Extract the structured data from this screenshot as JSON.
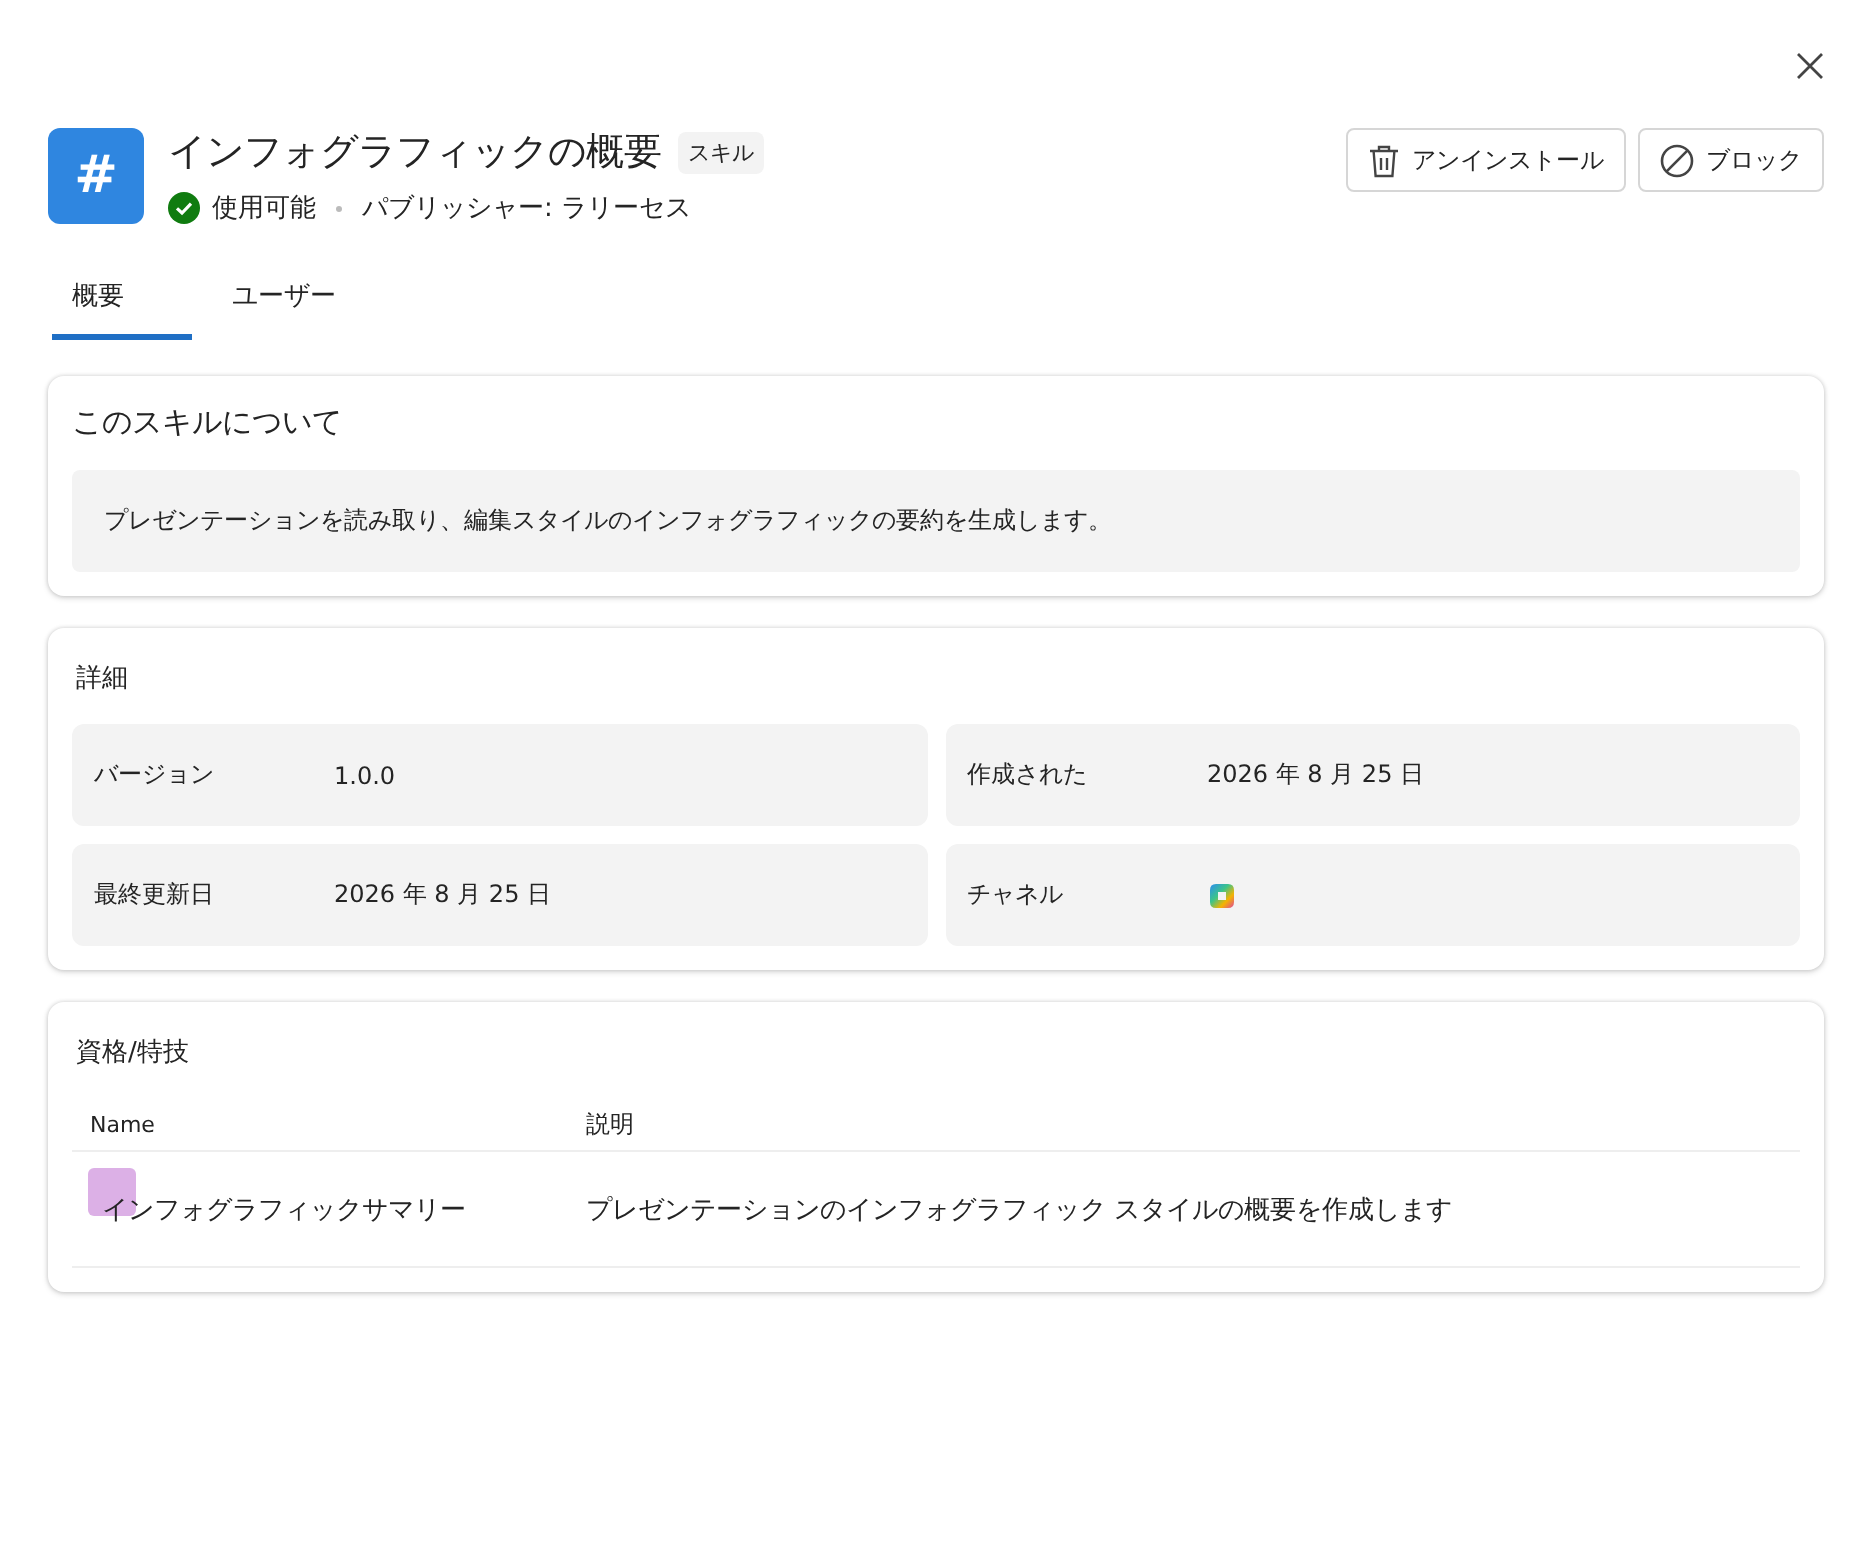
{
  "header": {
    "icon_glyph": "#",
    "title": "インフォグラフィックの概要",
    "badge": "スキル",
    "status": "使用可能",
    "publisher": "パブリッシャー: ラリーセス"
  },
  "actions": [
    {
      "kind": "uninstall",
      "label": "アンインストール"
    },
    {
      "kind": "block",
      "label": "ブロック"
    }
  ],
  "tabs": [
    {
      "label": "概要",
      "selected": true
    },
    {
      "label": "ユーザー",
      "selected": false
    }
  ],
  "about": {
    "title": "このスキルについて",
    "description": "プレゼンテーションを読み取り、編集スタイルのインフォグラフィックの要約を生成します。"
  },
  "details": {
    "title": "詳細",
    "fields": [
      {
        "label": "バージョン",
        "kind": "text",
        "value": "1.0.0"
      },
      {
        "label": "作成された",
        "kind": "text",
        "value": "2026 年 8 月 25 日"
      },
      {
        "label": "最終更新日",
        "kind": "text",
        "value": "2026 年 8 月 25 日"
      },
      {
        "label": "チャネル",
        "kind": "channel-icon"
      }
    ]
  },
  "capabilities": {
    "title": "資格/特技",
    "columns": [
      "Name",
      "説明"
    ],
    "rows": [
      {
        "name": "インフォグラフィックサマリー",
        "description": "プレゼンテーションのインフォグラフィック スタイルの概要を作成します"
      }
    ]
  }
}
